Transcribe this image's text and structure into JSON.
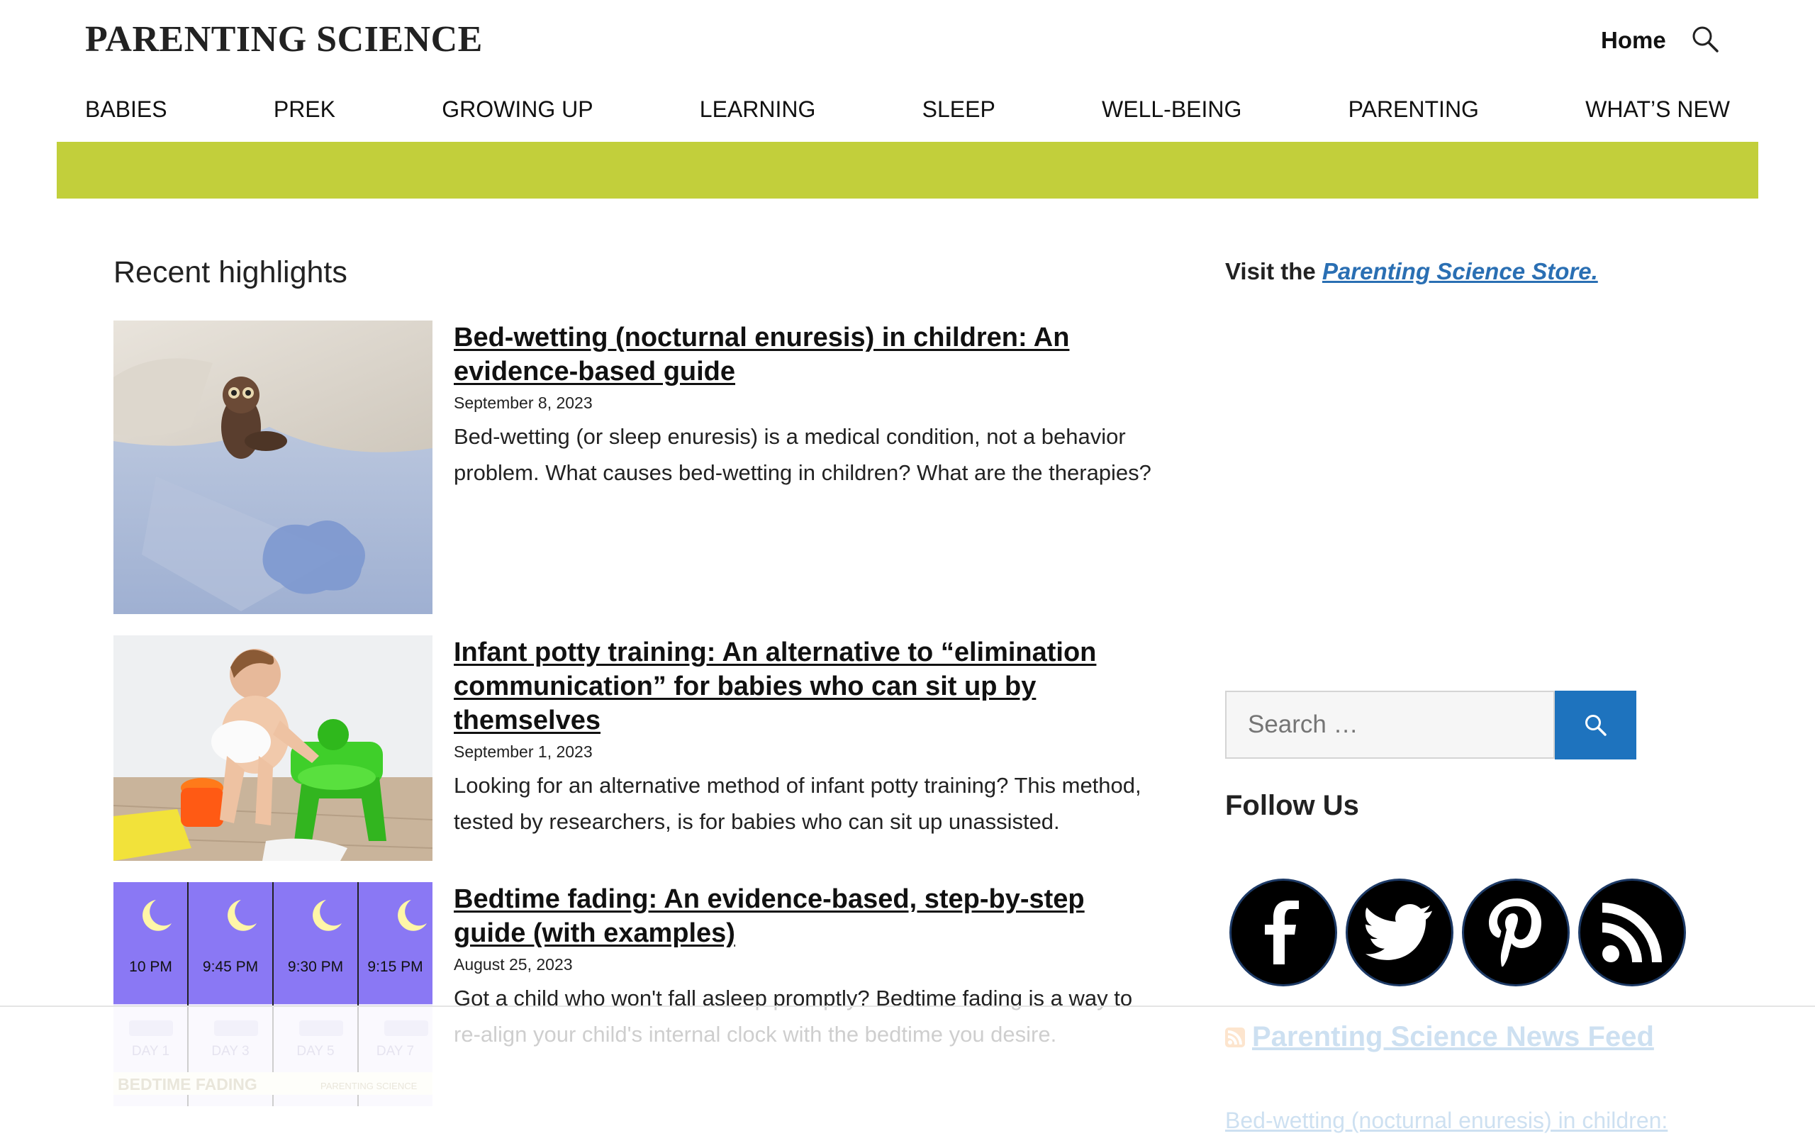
{
  "header": {
    "site_title": "PARENTING SCIENCE",
    "home_label": "Home",
    "search_icon": "search-icon"
  },
  "nav": {
    "items": [
      "BABIES",
      "PREK",
      "GROWING UP",
      "LEARNING",
      "SLEEP",
      "WELL-BEING",
      "PARENTING",
      "WHAT’S NEW"
    ]
  },
  "colors": {
    "band": "#c2cf3b",
    "link_blue": "#1e73be",
    "store_link": "#2a6fb3"
  },
  "main": {
    "section_title": "Recent highlights",
    "posts": [
      {
        "title": "Bed-wetting (nocturnal enuresis) in children: An evidence-based guide",
        "date": "September 8, 2023",
        "excerpt": "Bed-wetting (or sleep enuresis) is a medical condition, not a behavior problem. What causes bed-wetting in children? What are the therapies?"
      },
      {
        "title": "Infant potty training: An alternative to “elimination communication” for babies who can sit up by themselves",
        "date": "September 1, 2023",
        "excerpt": "Looking for an alternative method of infant potty training? This method, tested by researchers, is for babies who can sit up unassisted."
      },
      {
        "title": "Bedtime fading: An evidence-based, step-by-step guide (with examples)",
        "date": "August 25, 2023",
        "excerpt": "Got a child who won't fall asleep promptly? Bedtime fading is a way to re-align your child's internal clock with the bedtime you desire.",
        "thumb": {
          "times": [
            "10 PM",
            "9:45 PM",
            "9:30 PM",
            "9:15 PM"
          ],
          "days": [
            "DAY 1",
            "DAY 3",
            "DAY 5",
            "DAY 7"
          ],
          "caption": "BEDTIME FADING",
          "brand": "PARENTING SCIENCE"
        }
      }
    ]
  },
  "sidebar": {
    "store_prefix": "Visit the ",
    "store_link": "Parenting Science Store.",
    "search_placeholder": "Search …",
    "follow_title": "Follow Us",
    "social_icons": [
      "facebook-icon",
      "twitter-icon",
      "pinterest-icon",
      "rss-icon"
    ],
    "feed_title": "Parenting Science News Feed",
    "feed_first_item": "Bed-wetting (nocturnal enuresis) in children:"
  }
}
